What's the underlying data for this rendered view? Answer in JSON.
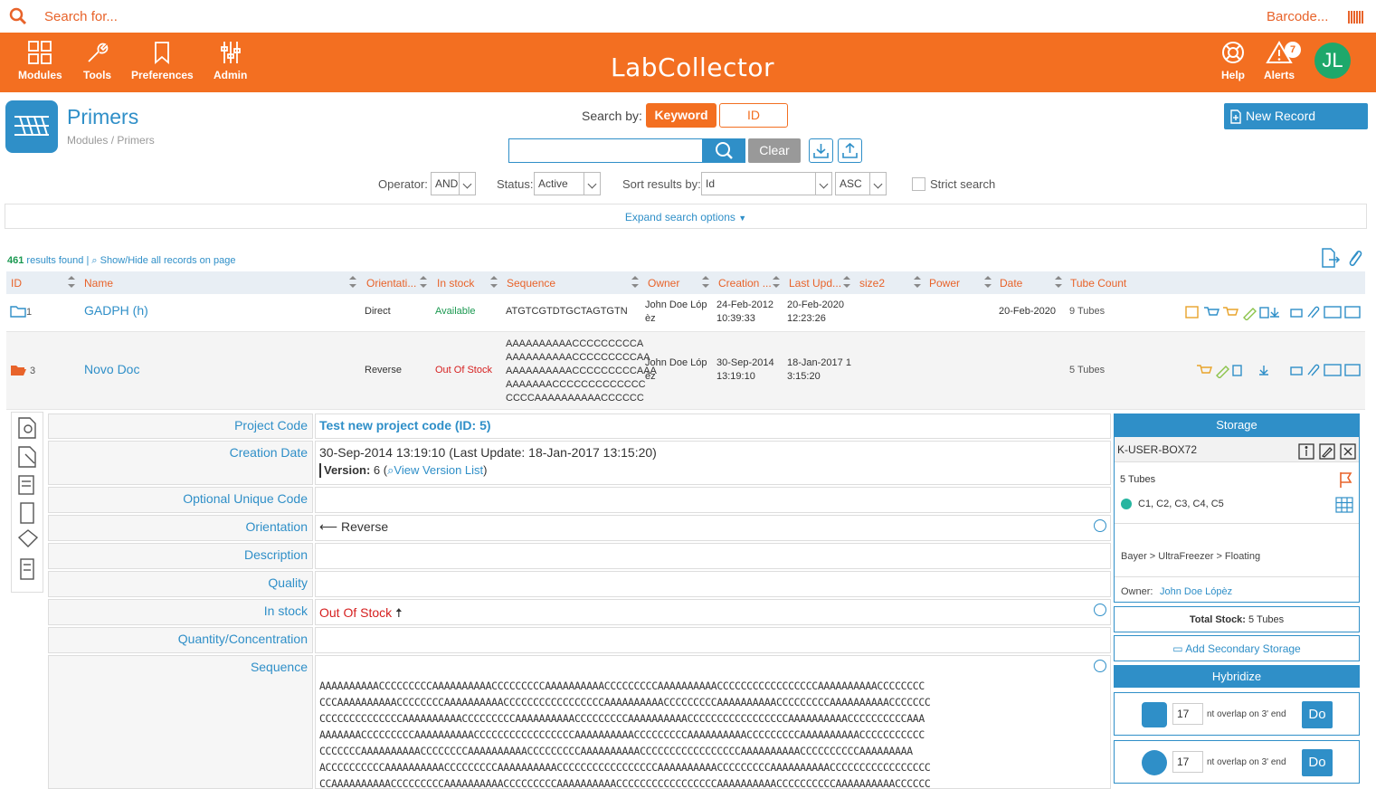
{
  "topbar": {
    "search_placeholder": "Search for...",
    "barcode_label": "Barcode..."
  },
  "nav": {
    "items": [
      {
        "label": "Modules"
      },
      {
        "label": "Tools"
      },
      {
        "label": "Preferences"
      },
      {
        "label": "Admin"
      }
    ],
    "logo": "LabCollector",
    "help_label": "Help",
    "alerts_label": "Alerts",
    "alerts_count": "7",
    "avatar_initials": "JL"
  },
  "module": {
    "title": "Primers",
    "breadcrumb": "Modules / Primers"
  },
  "search": {
    "search_by_label": "Search by:",
    "keyword_label": "Keyword",
    "id_label": "ID",
    "clear_label": "Clear",
    "new_record_label": "New Record",
    "operator_label": "Operator:",
    "operator_value": "AND",
    "status_label": "Status:",
    "status_value": "Active",
    "sort_label": "Sort results by:",
    "sort_value": "Id",
    "order_value": "ASC",
    "strict_label": "Strict search",
    "expand_label": "Expand search options"
  },
  "results": {
    "count": "461",
    "count_suffix": "results found",
    "showhide": "Show/Hide all records on page"
  },
  "table": {
    "headers": [
      "ID",
      "Name",
      "Orientati...",
      "In stock",
      "Sequence",
      "Owner",
      "Creation ...",
      "Last Upd...",
      "size2",
      "Power",
      "Date",
      "Tube Count"
    ],
    "rows": [
      {
        "id": "1",
        "name": "GADPH (h)",
        "orientation": "Direct",
        "stock": "Available",
        "sequence": "ATGTCGTDTGCTAGTGTN",
        "owner_1": "John Doe Lóp",
        "owner_2": "èz",
        "created_1": "24-Feb-2012",
        "created_2": "10:39:33",
        "updated_1": "20-Feb-2020",
        "updated_2": "12:23:26",
        "date": "20-Feb-2020",
        "tubes": "9 Tubes"
      },
      {
        "id": "3",
        "name": "Novo Doc",
        "orientation": "Reverse",
        "stock": "Out Of Stock",
        "sequence_lines": [
          "AAAAAAAAAACCCCCCCCCA",
          "AAAAAAAAAACCCCCCCCCAA",
          "AAAAAAAAAACCCCCCCCCAAA",
          "AAAAAAACCCCCCCCCCCCC",
          "CCCCAAAAAAAAAACCCCCC"
        ],
        "owner_1": "John Doe Lóp",
        "owner_2": "èz",
        "created_1": "30-Sep-2014",
        "created_2": "13:19:10",
        "updated_1": "18-Jan-2017 1",
        "updated_2": "3:15:20",
        "date": "",
        "tubes": "5 Tubes"
      }
    ]
  },
  "detail": {
    "project_code_label": "Project Code",
    "project_code_value": "Test new project code (ID: 5)",
    "creation_label": "Creation Date",
    "creation_value": "30-Sep-2014 13:19:10 (Last Update: 18-Jan-2017 13:15:20)",
    "version_label": "Version:",
    "version_value": "6",
    "version_link": "View Version List",
    "unique_label": "Optional Unique Code",
    "orientation_label": "Orientation",
    "orientation_value": "Reverse",
    "description_label": "Description",
    "quality_label": "Quality",
    "stock_label": "In stock",
    "stock_value": "Out Of Stock",
    "quantity_label": "Quantity/Concentration",
    "sequence_label": "Sequence",
    "sequence_lines": [
      "AAAAAAAAAACCCCCCCCCAAAAAAAAAACCCCCCCCCAAAAAAAAAACCCCCCCCCAAAAAAAAAACCCCCCCCCCCCCCCCCAAAAAAAAAACCCCCCCC",
      "CCCAAAAAAAAAACCCCCCCCAAAAAAAAAACCCCCCCCCCCCCCCCCAAAAAAAAAACCCCCCCCCAAAAAAAAAACCCCCCCCCAAAAAAAAAACCCCCCC",
      "CCCCCCCCCCCCCCAAAAAAAAAACCCCCCCCCAAAAAAAAAACCCCCCCCCAAAAAAAAAACCCCCCCCCCCCCCCCCAAAAAAAAAACCCCCCCCCCAAA",
      "AAAAAAACCCCCCCCCAAAAAAAAAACCCCCCCCCCCCCCCCCAAAAAAAAAACCCCCCCCCAAAAAAAAAACCCCCCCCCAAAAAAAAAACCCCCCCCCCC",
      "CCCCCCCAAAAAAAAAACCCCCCCCAAAAAAAAAACCCCCCCCCAAAAAAAAAACCCCCCCCCCCCCCCCCAAAAAAAAAACCCCCCCCCCAAAAAAAAA",
      "ACCCCCCCCCCAAAAAAAAAACCCCCCCCCAAAAAAAAAACCCCCCCCCCCCCCCCCAAAAAAAAAACCCCCCCCCAAAAAAAAAACCCCCCCCCCCCCCCCC",
      "CCAAAAAAAAAACCCCCCCCCAAAAAAAAAACCCCCCCCCAAAAAAAAAACCCCCCCCCCCCCCCCCAAAAAAAAAACCCCCCCCCCAAAAAAAAAACCCCCC"
    ]
  },
  "storage": {
    "header": "Storage",
    "box": "K-USER-BOX72",
    "tubes": "5 Tubes",
    "positions": "C1, C2, C3, C4, C5",
    "path": "Bayer > UltraFreezer > Floating",
    "owner_label": "Owner:",
    "owner_value": "John Doe Lópèz",
    "total_label": "Total Stock:",
    "total_value": "5 Tubes",
    "add_secondary": "Add Secondary Storage"
  },
  "hybridize": {
    "header": "Hybridize",
    "rows": [
      {
        "value": "17",
        "label": "nt overlap on 3' end",
        "button": "Do"
      },
      {
        "value": "17",
        "label": "nt overlap on 3' end",
        "button": "Do"
      }
    ]
  },
  "colors": {
    "accent": "#f36f21",
    "blue": "#2f8fc8",
    "green": "#1a9850",
    "red": "#d62020"
  }
}
